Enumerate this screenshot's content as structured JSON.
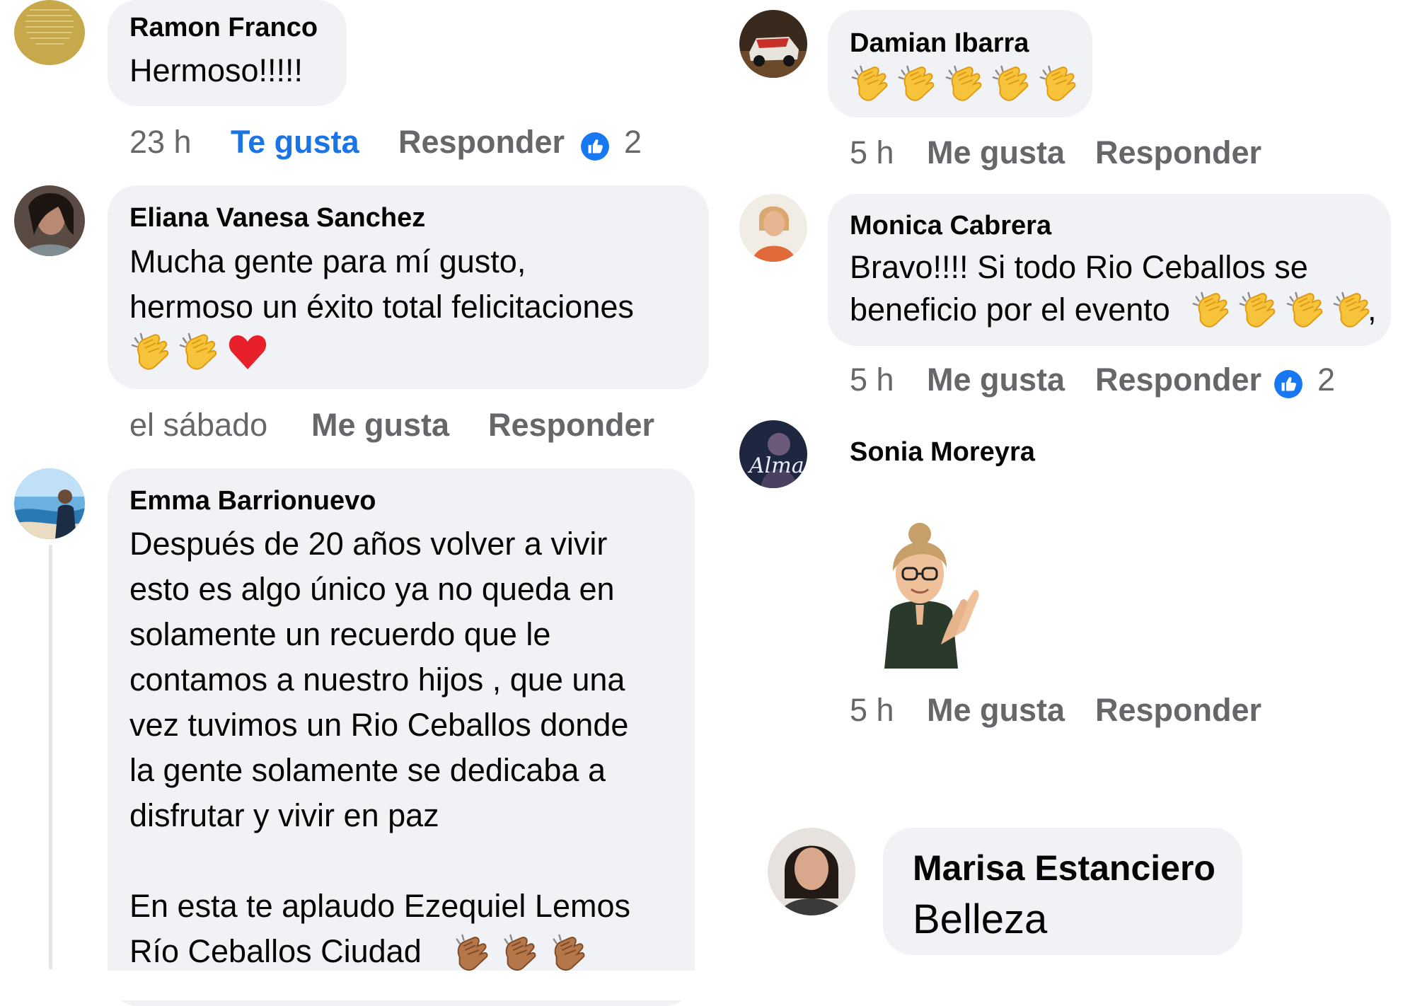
{
  "colors": {
    "bubble": "#f0f2f5",
    "meta": "#65676b",
    "liked": "#1b74e4",
    "like_icon": "#1877f2"
  },
  "left": [
    {
      "name": "Ramon Franco",
      "lines": [
        "Hermoso!!!!!"
      ],
      "time": "23 h",
      "like_label": "Te gusta",
      "reply_label": "Responder",
      "reactions": "2"
    },
    {
      "name": "Eliana Vanesa Sanchez",
      "lines": [
        "Mucha gente para mí gusto,",
        "hermoso un éxito total felicitaciones"
      ],
      "time": "el sábado",
      "like_label": "Me gusta",
      "reply_label": "Responder"
    },
    {
      "name": "Emma Barrionuevo",
      "lines": [
        "Después de 20 años volver a vivir",
        "esto es algo único ya no queda en",
        "solamente un recuerdo que le",
        "contamos a nuestro hijos ,  que una",
        "vez tuvimos un Rio Ceballos donde",
        "la gente solamente se dedicaba a",
        "disfrutar y vivir en paz",
        "",
        "En esta te aplaudo Ezequiel Lemos",
        "Río Ceballos Ciudad"
      ]
    }
  ],
  "right": [
    {
      "name": "Damian Ibarra",
      "time": "5 h",
      "like_label": "Me gusta",
      "reply_label": "Responder"
    },
    {
      "name": "Monica Cabrera",
      "lines": [
        "Bravo!!!! Si todo Rio Ceballos se",
        "beneficio por el evento"
      ],
      "tail": ",",
      "time": "5 h",
      "like_label": "Me gusta",
      "reply_label": "Responder",
      "reactions": "2"
    },
    {
      "name": "Sonia Moreyra",
      "time": "5 h",
      "like_label": "Me gusta",
      "reply_label": "Responder"
    },
    {
      "name": "Marisa Estanciero",
      "lines": [
        "Belleza"
      ]
    }
  ],
  "icons": {
    "clap": "clapping-hands-icon",
    "heart": "red-heart-icon",
    "like": "like-thumb-icon"
  }
}
